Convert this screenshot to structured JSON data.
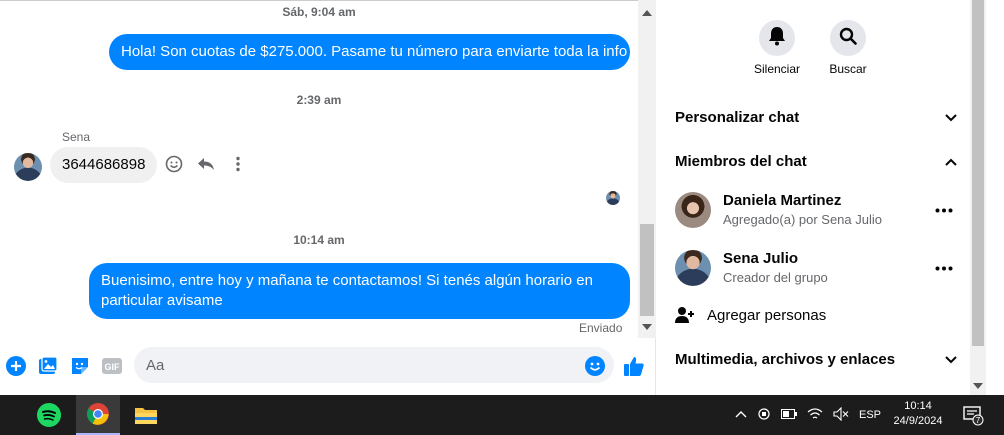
{
  "chat": {
    "timestamp_1": "Sáb, 9:04 am",
    "outgoing_1": "Hola! Son cuotas de $275.000. Pasame tu número para enviarte toda la info",
    "timestamp_2": "2:39 am",
    "incoming_sender": "Sena",
    "incoming_1": "3644686898",
    "timestamp_3": "10:14 am",
    "outgoing_2": "Buenisimo, entre hoy y mañana te contactamos! Si tenés algún horario en particular avisame",
    "delivery_status": "Enviado"
  },
  "composer": {
    "placeholder": "Aa",
    "icons": [
      "plus-icon",
      "photo-icon",
      "sticker-icon",
      "gif-icon",
      "emoji-icon",
      "like-icon"
    ],
    "gif_label": "GIF"
  },
  "panel": {
    "mute_label": "Silenciar",
    "search_label": "Buscar",
    "customize_chat": "Personalizar chat",
    "chat_members": "Miembros del chat",
    "members": [
      {
        "name": "Daniela Martinez",
        "role": "Agregado(a) por Sena Julio"
      },
      {
        "name": "Sena Julio",
        "role": "Creador del grupo"
      }
    ],
    "add_people": "Agregar personas",
    "media_files_links": "Multimedia, archivos y enlaces"
  },
  "taskbar": {
    "apps": [
      "spotify-icon",
      "chrome-icon",
      "file-explorer-icon"
    ],
    "language": "ESP",
    "time": "10:14",
    "date": "24/9/2024",
    "notification_count": "7"
  },
  "colors": {
    "accent": "#0084ff",
    "bubble_in": "#f0f0f0",
    "taskbar": "#1c1c1c"
  }
}
